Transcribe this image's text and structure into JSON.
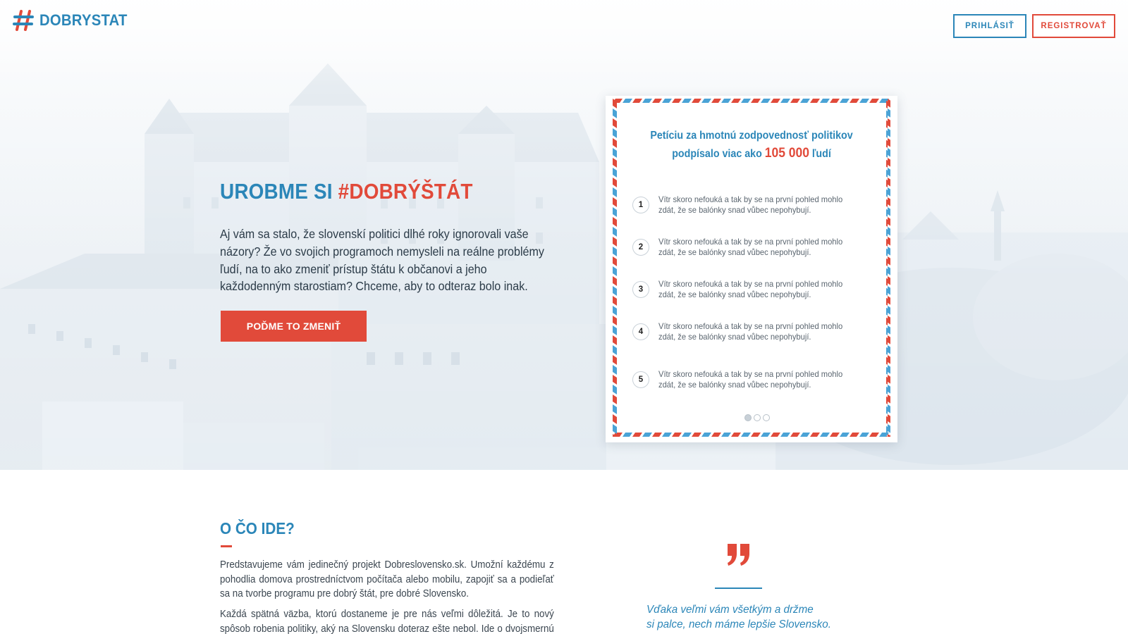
{
  "header": {
    "logo_text": "DOBRYSTAT",
    "login_label": "PRIHLÁSIŤ",
    "register_label": "REGISTROVAŤ"
  },
  "hero": {
    "title_part1": "UROBME SI ",
    "title_part2": "#DOBRÝŠTÁT",
    "text": "Aj vám sa stalo, že slovenskí politici dlhé roky ignorovali vaše názory? Že vo svojich programoch nemysleli na reálne problémy ľudí, na to ako zmeniť prístup štátu k občanovi a jeho každodenným starostiam? Chceme, aby to odteraz bolo inak.",
    "cta_label": "POĎME TO ZMENIŤ"
  },
  "petition": {
    "headline_line1": "Petíciu za hmotnú zodpovednosť politikov",
    "headline_line2_prefix": "podpísalo viac ako ",
    "count": "105 000",
    "headline_line2_suffix": " ľudí",
    "items": [
      {
        "number": "1",
        "text": "Vítr skoro nefouká a tak by se na první pohled mohlo zdát, že se balónky snad vůbec nepohybují."
      },
      {
        "number": "2",
        "text": "Vítr skoro nefouká a tak by se na první pohled mohlo zdát, že se balónky snad vůbec nepohybují."
      },
      {
        "number": "3",
        "text": "Vítr skoro nefouká a tak by se na první pohled mohlo zdát, že se balónky snad vůbec nepohybují."
      },
      {
        "number": "4",
        "text": "Vítr skoro nefouká a tak by se na první pohled mohlo zdát, že se balónky snad vůbec nepohybují."
      },
      {
        "number": "5",
        "text": "Vítr skoro nefouká a tak by se na první pohled mohlo zdát, že se balónky snad vůbec nepohybují."
      }
    ],
    "pagination_count": 3,
    "pagination_active": 1
  },
  "about": {
    "title": "O ČO IDE?",
    "paragraph1": "Predstavujeme vám jedinečný projekt Dobreslovensko.sk. Umožní každému z pohodlia domova prostredníctvom počítača alebo mobilu, zapojiť sa a podieľať sa na tvorbe programu pre dobrý štát, pre dobré Slovensko.",
    "paragraph2": "Každá spätná väzba, ktorú dostaneme je pre nás veľmi dôležitá. Je to nový spôsob robenia politiky, aký na Slovensku doteraz ešte nebol. Ide o dvojsmernú komu-"
  },
  "quote": {
    "line1": "Vďaka veľmi vám všetkým a držme",
    "line2": "si palce, nech máme lepšie Slovensko."
  },
  "colors": {
    "brand_blue": "#2b86b8",
    "brand_red": "#e14a3a"
  }
}
